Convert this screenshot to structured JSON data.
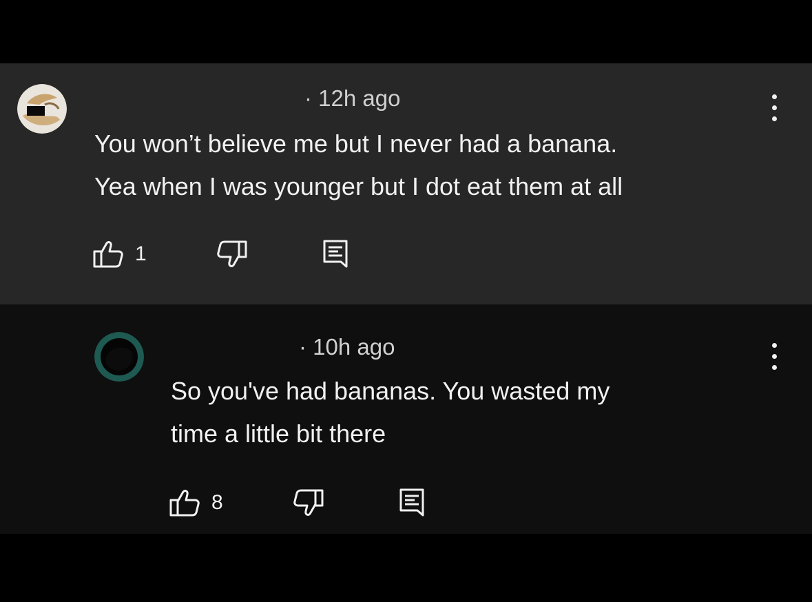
{
  "comments": [
    {
      "timestamp": "· 12h ago",
      "text_lines": [
        "You won’t believe me but I never had a banana.",
        "Yea when I was younger but I dot eat them at all"
      ],
      "like_count": "1",
      "avatar": "banana-photo-avatar",
      "background": "#272727"
    },
    {
      "timestamp": "· 10h ago",
      "text_lines": [
        "So you've had bananas. You wasted my",
        "time a little bit there"
      ],
      "like_count": "8",
      "avatar": "dark-teal-ring-avatar",
      "background": "#0f0f0f"
    }
  ],
  "icons": {
    "like": "thumbs-up-icon",
    "dislike": "thumbs-down-icon",
    "reply": "reply-comment-icon",
    "more": "vertical-dots-menu-icon"
  },
  "colors": {
    "text": "#f1f1f1",
    "secondary_text": "#d0d0d0",
    "reply_ring": "#1e5a52"
  }
}
